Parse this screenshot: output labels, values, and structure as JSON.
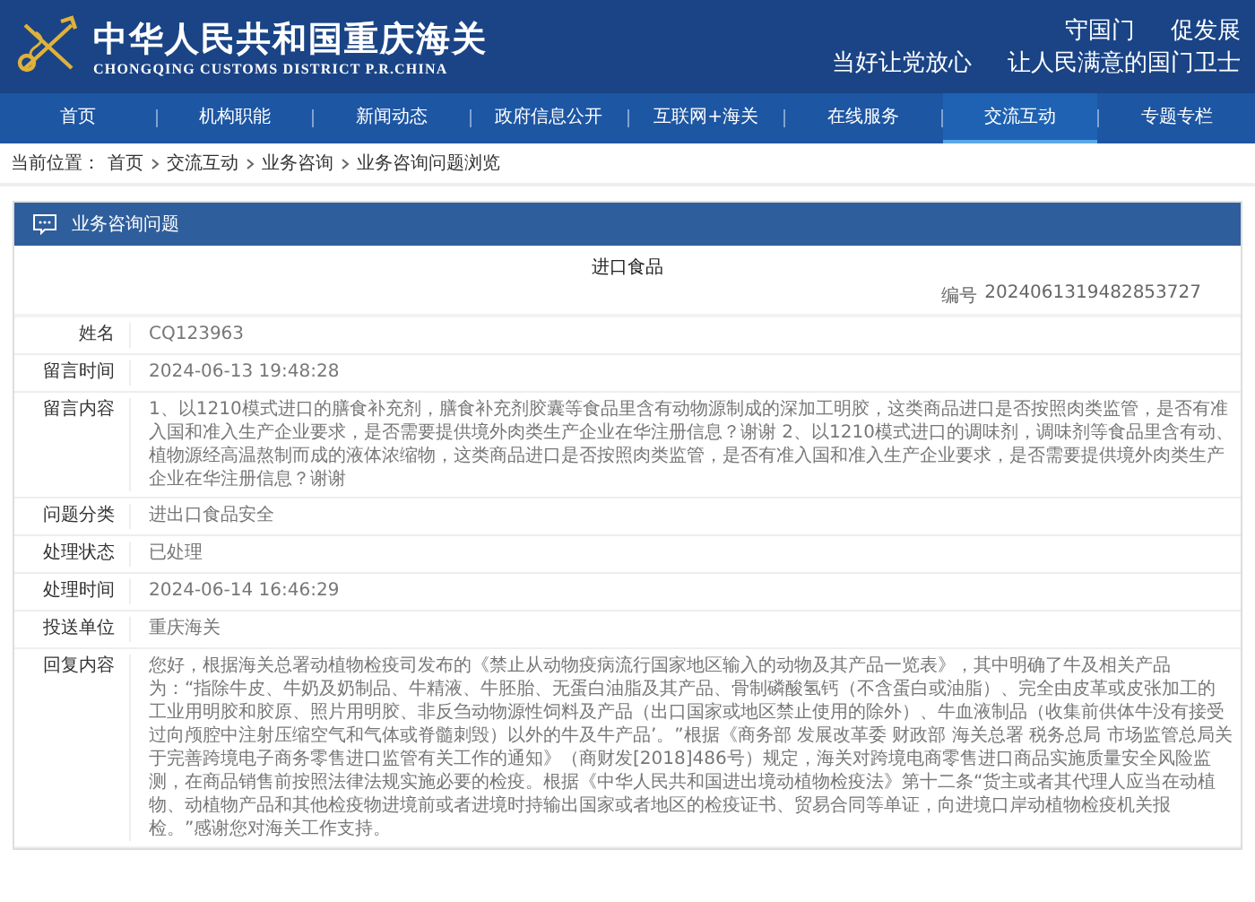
{
  "header": {
    "title": "中华人民共和国重庆海关",
    "subtitle": "CHONGQING CUSTOMS DISTRICT P.R.CHINA",
    "slogans": [
      [
        "守国门",
        "促发展"
      ],
      [
        "当好让党放心",
        "让人民满意的国门卫士"
      ]
    ]
  },
  "nav": [
    {
      "label": "首页",
      "selected": false
    },
    {
      "label": "机构职能",
      "selected": false
    },
    {
      "label": "新闻动态",
      "selected": false
    },
    {
      "label": "政府信息公开",
      "selected": false
    },
    {
      "label": "互联网+海关",
      "selected": false
    },
    {
      "label": "在线服务",
      "selected": false
    },
    {
      "label": "交流互动",
      "selected": true
    },
    {
      "label": "专题专栏",
      "selected": false
    }
  ],
  "breadcrumb": {
    "label": "当前位置：",
    "items": [
      "首页",
      "交流互动",
      "业务咨询",
      "业务咨询问题浏览"
    ]
  },
  "panel": {
    "title": "业务咨询问题",
    "subject": "进口食品",
    "number_label": "编号",
    "number": "2024061319482853727",
    "fields": [
      {
        "label": "姓名",
        "value": "CQ123963"
      },
      {
        "label": "留言时间",
        "value": "2024-06-13 19:48:28"
      },
      {
        "label": "留言内容",
        "value": "1、以1210模式进口的膳食补充剂，膳食补充剂胶囊等食品里含有动物源制成的深加工明胶，这类商品进口是否按照肉类监管，是否有准入国和准入生产企业要求，是否需要提供境外肉类生产企业在华注册信息？谢谢 2、以1210模式进口的调味剂，调味剂等食品里含有动、植物源经高温熬制而成的液体浓缩物，这类商品进口是否按照肉类监管，是否有准入国和准入生产企业要求，是否需要提供境外肉类生产企业在华注册信息？谢谢"
      },
      {
        "label": "问题分类",
        "value": "进出口食品安全"
      },
      {
        "label": "处理状态",
        "value": "已处理"
      },
      {
        "label": "处理时间",
        "value": "2024-06-14 16:46:29"
      },
      {
        "label": "投送单位",
        "value": "重庆海关"
      },
      {
        "label": "回复内容",
        "value": "您好，根据海关总署动植物检疫司发布的《禁止从动物疫病流行国家地区输入的动物及其产品一览表》，其中明确了牛及相关产品为：“指除牛皮、牛奶及奶制品、牛精液、牛胚胎、无蛋白油脂及其产品、骨制磷酸氢钙（不含蛋白或油脂）、完全由皮革或皮张加工的工业用明胶和胶原、照片用明胶、非反刍动物源性饲料及产品（出口国家或地区禁止使用的除外）、牛血液制品（收集前供体牛没有接受过向颅腔中注射压缩空气和气体或脊髓刺毁）以外的牛及牛产品’。”根据《商务部 发展改革委 财政部 海关总署 税务总局 市场监管总局关于完善跨境电子商务零售进口监管有关工作的通知》（商财发[2018]486号）规定，海关对跨境电商零售进口商品实施质量安全风险监测，在商品销售前按照法律法规实施必要的检疫。根据《中华人民共和国进出境动植物检疫法》第十二条“货主或者其代理人应当在动植物、动植物产品和其他检疫物进境前或者进境时持输出国家或者地区的检疫证书、贸易合同等单证，向进境口岸动植物检疫机关报检。”感谢您对海关工作支持。"
      }
    ]
  }
}
